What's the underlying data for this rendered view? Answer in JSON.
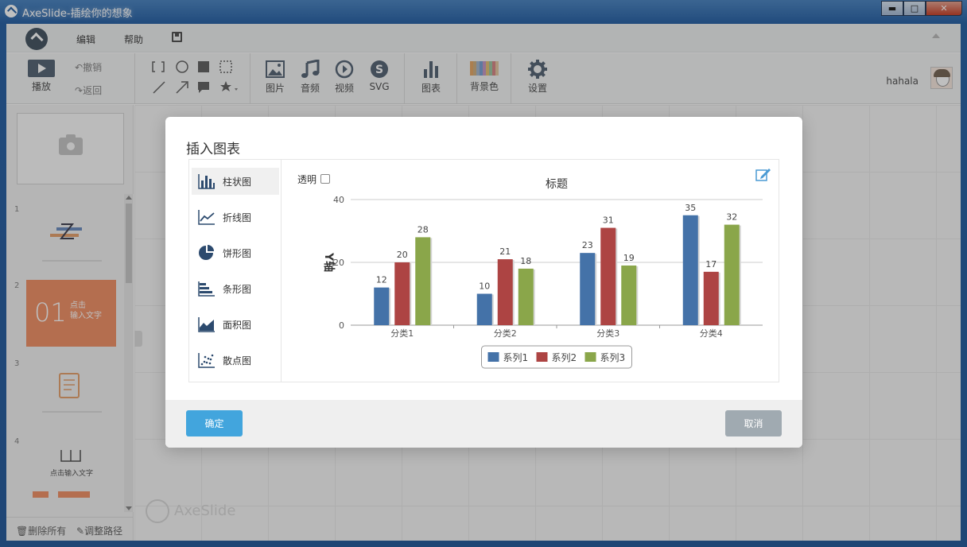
{
  "window": {
    "title": "AxeSlide-插绘你的想象",
    "btn_min": "▬",
    "btn_max": "□",
    "btn_close": "✕"
  },
  "menu": {
    "edit": "编辑",
    "help": "帮助"
  },
  "toolbar": {
    "play": "播放",
    "undo": "撤销",
    "redo": "返回",
    "image": "图片",
    "audio": "音频",
    "video": "视频",
    "svg": "SVG",
    "chart": "图表",
    "bgcolor": "背景色",
    "settings": "设置"
  },
  "user": {
    "name": "hahala"
  },
  "slides": [
    {
      "num": "1"
    },
    {
      "num": "2",
      "big": "01",
      "line1": "点击",
      "line2": "输入文字"
    },
    {
      "num": "3"
    },
    {
      "num": "4",
      "caption": "点击输入文字"
    }
  ],
  "leftpanel": {
    "delete_all": "删除所有",
    "adjust_path": "调整路径"
  },
  "watermark": "AxeSlide",
  "dialog": {
    "title": "插入图表",
    "transparent": "透明",
    "ok": "确定",
    "cancel": "取消",
    "chart_types": [
      {
        "label": "柱状图",
        "icon": "bar-chart-icon"
      },
      {
        "label": "折线图",
        "icon": "line-chart-icon"
      },
      {
        "label": "饼形图",
        "icon": "pie-chart-icon"
      },
      {
        "label": "条形图",
        "icon": "horizontal-bar-chart-icon"
      },
      {
        "label": "面积图",
        "icon": "area-chart-icon"
      },
      {
        "label": "散点图",
        "icon": "scatter-chart-icon"
      }
    ]
  },
  "chart_data": {
    "type": "bar",
    "title": "标题",
    "ylabel": "Y轴",
    "xlabel": "",
    "ylim": [
      0,
      40
    ],
    "yticks": [
      0,
      20,
      40
    ],
    "grid": true,
    "legend_position": "bottom",
    "categories": [
      "分类1",
      "分类2",
      "分类3",
      "分类4"
    ],
    "series": [
      {
        "name": "系列1",
        "color": "#4472a8",
        "values": [
          12,
          10,
          23,
          35
        ]
      },
      {
        "name": "系列2",
        "color": "#ad4443",
        "values": [
          20,
          21,
          31,
          17
        ]
      },
      {
        "name": "系列3",
        "color": "#8aa64a",
        "values": [
          28,
          18,
          19,
          32
        ]
      }
    ]
  }
}
